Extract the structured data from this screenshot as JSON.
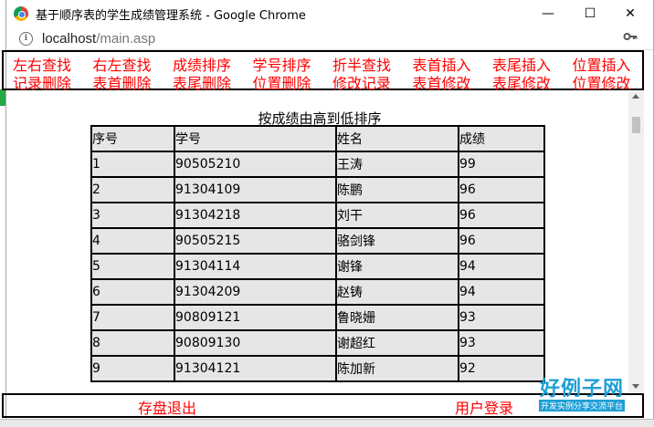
{
  "window": {
    "title": "基于顺序表的学生成绩管理系统 - Google Chrome",
    "minimize_glyph": "—",
    "maximize_glyph": "☐",
    "close_glyph": "✕"
  },
  "address": {
    "host": "localhost",
    "path": "/main.asp",
    "info_glyph": "i",
    "key_icon": "key-icon"
  },
  "nav": {
    "row1": [
      "左右查找",
      "右左查找",
      "成绩排序",
      "学号排序",
      "折半查找",
      "表首插入",
      "表尾插入",
      "位置插入"
    ],
    "row2": [
      "记录删除",
      "表首删除",
      "表尾删除",
      "位置删除",
      "修改记录",
      "表首修改",
      "表尾修改",
      "位置修改"
    ]
  },
  "content": {
    "caption": "按成绩由高到低排序",
    "columns": [
      "序号",
      "学号",
      "姓名",
      "成绩"
    ],
    "rows": [
      [
        "1",
        "90505210",
        "王涛",
        "99"
      ],
      [
        "2",
        "91304109",
        "陈鹏",
        "96"
      ],
      [
        "3",
        "91304218",
        "刘干",
        "96"
      ],
      [
        "4",
        "90505215",
        "骆剑锋",
        "96"
      ],
      [
        "5",
        "91304114",
        "谢锋",
        "94"
      ],
      [
        "6",
        "91304209",
        "赵铸",
        "94"
      ],
      [
        "7",
        "90809121",
        "鲁晓姗",
        "93"
      ],
      [
        "8",
        "90809130",
        "谢超红",
        "93"
      ],
      [
        "9",
        "91304121",
        "陈加新",
        "92"
      ]
    ]
  },
  "footer": {
    "save_exit": "存盘退出",
    "user_login": "用户登录"
  },
  "watermark": {
    "brand": "好例子网",
    "tagline": "开发实例分享交流平台"
  },
  "colors": {
    "link_red": "#ff0000",
    "table_bg": "#e6e6e6"
  }
}
